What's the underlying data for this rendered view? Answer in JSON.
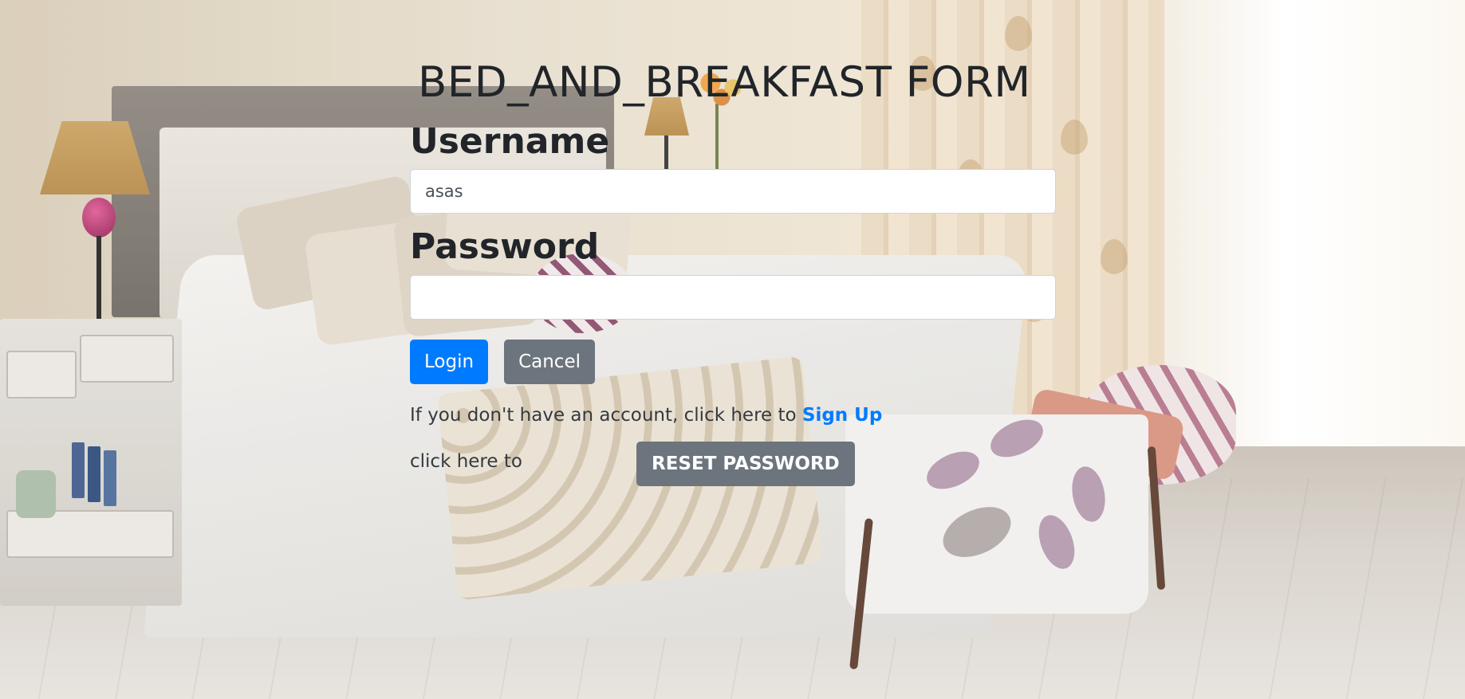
{
  "form": {
    "title": "BED_AND_BREAKFAST FORM",
    "username_label": "Username",
    "username_value": "asas",
    "password_label": "Password",
    "password_value": "",
    "login_label": "Login",
    "cancel_label": "Cancel",
    "signup_prefix": "If you don't have an account, click here to ",
    "signup_link": "Sign Up",
    "reset_prefix": "click here to",
    "reset_label": "RESET PASSWORD"
  },
  "colors": {
    "primary": "#007bff",
    "secondary": "#6c757d",
    "title_text": "#212529"
  }
}
